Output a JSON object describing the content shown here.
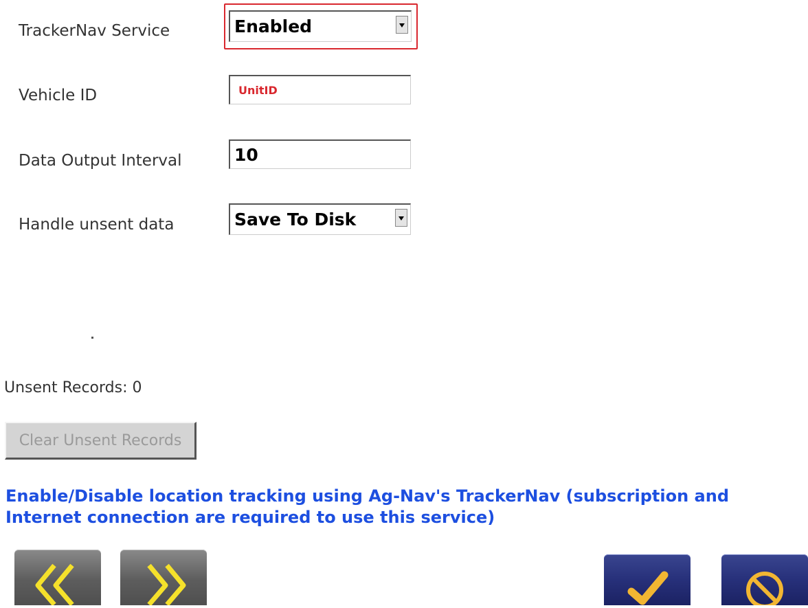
{
  "fields": {
    "service_label": "TrackerNav Service",
    "service_value": "Enabled",
    "vehicle_label": "Vehicle ID",
    "vehicle_value": "UnitID",
    "interval_label": "Data Output Interval",
    "interval_value": "10",
    "unsent_label": "Handle unsent data",
    "unsent_value": "Save To Disk"
  },
  "status": {
    "dot": ".",
    "unsent_records": "Unsent Records:  0"
  },
  "buttons": {
    "clear_unsent": "Clear Unsent Records"
  },
  "help_text": "Enable/Disable location tracking using Ag-Nav's TrackerNav (subscription and Internet connection are required to use this service)",
  "icons": {
    "previous": "double-chevron-left-icon",
    "next": "double-chevron-right-icon",
    "accept": "checkmark-icon",
    "cancel": "prohibited-icon"
  },
  "colors": {
    "focus_ring": "#d9272e",
    "vehicle_text": "#d9272e",
    "help_text": "#1d4fe0",
    "nav_arrows": "#f5e12b",
    "accept_check": "#f2b632",
    "cancel_symbol": "#f2b632"
  }
}
